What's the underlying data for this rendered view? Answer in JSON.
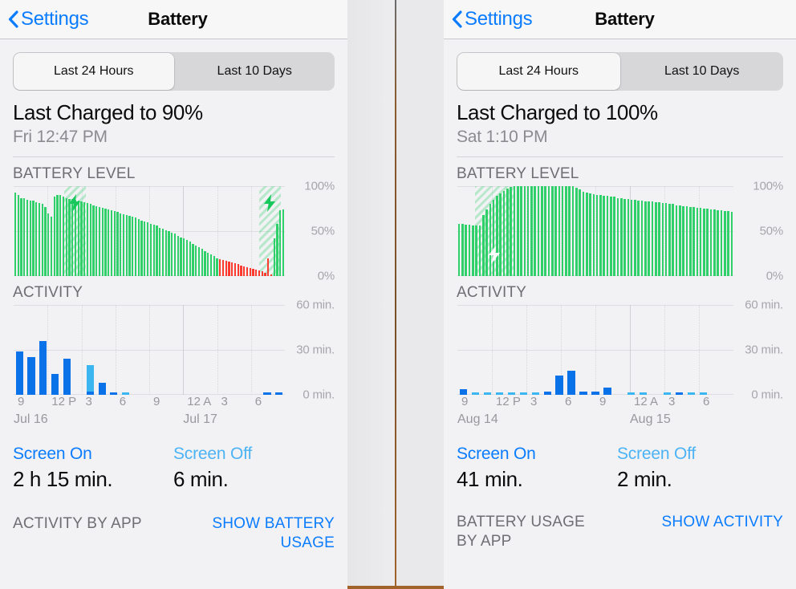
{
  "divider": {
    "color": "#8a5a2b"
  },
  "panels": [
    {
      "id": "left",
      "nav": {
        "back_label": "Settings",
        "title": "Battery",
        "back_icon": "chevron-left-icon"
      },
      "segmented": {
        "options": [
          "Last 24 Hours",
          "Last 10 Days"
        ],
        "selected": "Last 24 Hours"
      },
      "charged": {
        "title": "Last Charged to 90%",
        "subtitle": "Fri 12:47 PM"
      },
      "battery_section_title": "BATTERY LEVEL",
      "activity_section_title": "ACTIVITY",
      "screen_on": {
        "label": "Screen On",
        "value": "2 h 15 min."
      },
      "screen_off": {
        "label": "Screen Off",
        "value": "6 min."
      },
      "footer": {
        "label": "ACTIVITY BY APP",
        "link": "SHOW BATTERY USAGE"
      },
      "chart_data": [
        {
          "type": "bar",
          "name": "battery-level-chart",
          "title": "BATTERY LEVEL",
          "ylabel": "",
          "ylim": [
            0,
            100
          ],
          "yticks": [
            0,
            50,
            100
          ],
          "ytick_labels": [
            "0%",
            "50%",
            "100%"
          ],
          "bar_color_normal": "#2fd069",
          "bar_color_low": "#fc3b30",
          "charging_overlay_color": "#30d16e",
          "charging_bands": [
            [
              0.185,
              0.265
            ],
            [
              0.905,
              0.985
            ]
          ],
          "bolt_icon": "lightning-bolt-icon",
          "values": [
            93,
            90,
            87,
            87,
            85,
            84,
            84,
            82,
            81,
            80,
            77,
            70,
            66,
            88,
            90,
            90,
            88,
            87,
            86,
            86,
            85,
            84,
            83,
            82,
            81,
            80,
            79,
            78,
            77,
            76,
            75,
            74,
            73,
            72,
            71,
            70,
            69,
            68,
            67,
            66,
            65,
            63,
            62,
            61,
            60,
            58,
            57,
            56,
            54,
            53,
            51,
            50,
            48,
            47,
            45,
            43,
            42,
            40,
            38,
            36,
            34,
            32,
            30,
            28,
            26,
            24,
            22,
            20,
            19,
            18,
            17,
            16,
            15,
            14,
            13,
            12,
            11,
            10,
            9,
            8,
            7,
            6,
            5,
            4,
            20,
            2,
            42,
            58,
            73,
            74
          ],
          "low_from_index": 68,
          "low_to_index": 85
        },
        {
          "type": "bar",
          "name": "activity-chart",
          "title": "ACTIVITY",
          "ylim": [
            0,
            60
          ],
          "yticks": [
            0,
            30,
            60
          ],
          "ytick_labels": [
            "0 min.",
            "30 min.",
            "60 min."
          ],
          "xtick_labels": [
            "9",
            "12 P",
            "3",
            "6",
            "9",
            "12 A",
            "3",
            "6"
          ],
          "day_labels": [
            "Jul 16",
            "Jul 17"
          ],
          "series": [
            {
              "name": "Screen On",
              "color": "#0a72e8",
              "values": [
                29,
                25,
                36,
                14,
                24,
                0,
                2,
                8,
                1,
                0,
                0,
                0,
                0,
                0,
                0,
                0,
                0,
                0,
                0,
                0,
                0,
                1,
                1
              ]
            },
            {
              "name": "Screen Off",
              "color": "#3cb6f0",
              "values": [
                0,
                0,
                0,
                0,
                0,
                0,
                20,
                1,
                0,
                1,
                0,
                0,
                0,
                0,
                0,
                0,
                0,
                0,
                0,
                0,
                0,
                0,
                0
              ]
            }
          ]
        }
      ]
    },
    {
      "id": "right",
      "nav": {
        "back_label": "Settings",
        "title": "Battery",
        "back_icon": "chevron-left-icon"
      },
      "segmented": {
        "options": [
          "Last 24 Hours",
          "Last 10 Days"
        ],
        "selected": "Last 24 Hours"
      },
      "charged": {
        "title": "Last Charged to 100%",
        "subtitle": "Sat 1:10 PM"
      },
      "battery_section_title": "BATTERY LEVEL",
      "activity_section_title": "ACTIVITY",
      "screen_on": {
        "label": "Screen On",
        "value": "41 min."
      },
      "screen_off": {
        "label": "Screen Off",
        "value": "2 min."
      },
      "footer": {
        "label": "BATTERY USAGE BY APP",
        "link": "SHOW ACTIVITY"
      },
      "chart_data": [
        {
          "type": "bar",
          "name": "battery-level-chart",
          "title": "BATTERY LEVEL",
          "ylim": [
            0,
            100
          ],
          "yticks": [
            0,
            50,
            100
          ],
          "ytick_labels": [
            "0%",
            "50%",
            "100%"
          ],
          "bar_color_normal": "#2fd069",
          "charging_overlay_color": "#30d16e",
          "charging_bands": [
            [
              0.065,
              0.205
            ]
          ],
          "bolt_icon": "lightning-bolt-icon",
          "values": [
            58,
            58,
            57,
            57,
            56,
            56,
            56,
            68,
            74,
            80,
            85,
            89,
            92,
            95,
            97,
            99,
            100,
            100,
            100,
            100,
            100,
            100,
            100,
            100,
            100,
            100,
            100,
            100,
            100,
            100,
            100,
            100,
            100,
            100,
            98,
            96,
            94,
            93,
            92,
            91,
            90,
            90,
            89,
            89,
            88,
            88,
            87,
            87,
            86,
            86,
            85,
            85,
            84,
            84,
            83,
            83,
            83,
            82,
            82,
            81,
            81,
            80,
            80,
            79,
            79,
            78,
            78,
            77,
            77,
            76,
            76,
            75,
            75,
            74,
            74,
            73,
            73,
            72,
            72,
            71
          ]
        },
        {
          "type": "bar",
          "name": "activity-chart",
          "title": "ACTIVITY",
          "ylim": [
            0,
            60
          ],
          "yticks": [
            0,
            30,
            60
          ],
          "ytick_labels": [
            "0 min.",
            "30 min.",
            "60 min."
          ],
          "xtick_labels": [
            "9",
            "12 P",
            "3",
            "6",
            "9",
            "12 A",
            "3",
            "6"
          ],
          "day_labels": [
            "Aug 14",
            "Aug 15"
          ],
          "series": [
            {
              "name": "Screen On",
              "color": "#0a72e8",
              "values": [
                4,
                0,
                0,
                0,
                0,
                0,
                0,
                2,
                13,
                16,
                2,
                2,
                5,
                0,
                0,
                0,
                0,
                0,
                1,
                0,
                0,
                0,
                0
              ]
            },
            {
              "name": "Screen Off",
              "color": "#3cb6f0",
              "values": [
                0,
                1,
                1,
                1,
                1,
                1,
                1,
                0,
                0,
                0,
                0,
                0,
                0,
                0,
                1,
                1,
                0,
                1,
                0,
                1,
                1,
                0,
                0
              ]
            }
          ]
        }
      ]
    }
  ]
}
